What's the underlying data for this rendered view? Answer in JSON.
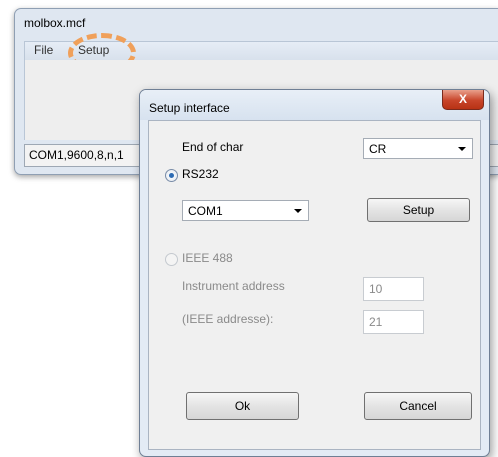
{
  "main_window": {
    "title": "molbox.mcf",
    "menu": {
      "file_label": "File",
      "setup_label": "Setup"
    },
    "status_text": "COM1,9600,8,n,1"
  },
  "dialog": {
    "title": "Setup interface",
    "close_label": "X",
    "end_of_char": {
      "label": "End of char",
      "value": "CR"
    },
    "rs232": {
      "label": "RS232",
      "selected": true,
      "port_value": "COM1",
      "setup_button_label": "Setup"
    },
    "ieee488": {
      "label": "IEEE 488",
      "selected": false,
      "enabled": false,
      "instrument_address_label": "Instrument address",
      "instrument_address_value": "10",
      "ieee_address_label": "(IEEE addresse):",
      "ieee_address_value": "21"
    },
    "ok_label": "Ok",
    "cancel_label": "Cancel"
  },
  "colors": {
    "highlight_ring": "#f0a05a",
    "radio_selected": "#2d6bb4",
    "close_button": "#c8452a"
  }
}
